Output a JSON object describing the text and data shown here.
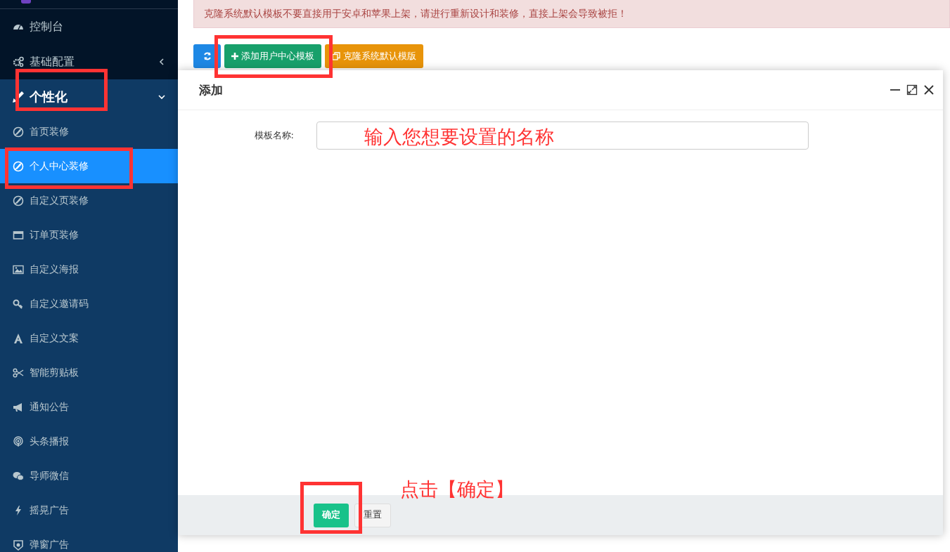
{
  "sidebar": {
    "items": [
      {
        "label": "控制台",
        "kind": "link",
        "selected": false
      },
      {
        "label": "基础配置",
        "kind": "group",
        "expanded": false,
        "selected": false
      },
      {
        "label": "个性化",
        "kind": "group",
        "expanded": true,
        "selected": false,
        "children": [
          {
            "label": "首页装修",
            "selected": false
          },
          {
            "label": "个人中心装修",
            "selected": true
          },
          {
            "label": "自定义页装修",
            "selected": false
          },
          {
            "label": "订单页装修",
            "selected": false
          },
          {
            "label": "自定义海报",
            "selected": false
          },
          {
            "label": "自定义邀请码",
            "selected": false
          },
          {
            "label": "自定义文案",
            "selected": false
          },
          {
            "label": "智能剪贴板",
            "selected": false
          },
          {
            "label": "通知公告",
            "selected": false
          },
          {
            "label": "头条播报",
            "selected": false
          },
          {
            "label": "导师微信",
            "selected": false
          },
          {
            "label": "摇晃广告",
            "selected": false
          },
          {
            "label": "弹窗广告",
            "selected": false
          }
        ]
      }
    ]
  },
  "alert": {
    "text": "克隆系统默认模板不要直接用于安卓和苹果上架，请进行重新设计和装修，直接上架会导致被拒！"
  },
  "toolbar": {
    "buttons": [
      {
        "kind": "refresh"
      },
      {
        "kind": "add",
        "label": "添加用户中心模板"
      },
      {
        "kind": "clone",
        "label": "克隆系统默认模版"
      }
    ]
  },
  "dialog": {
    "title": "添加",
    "fields": [
      {
        "label": "模板名称:"
      }
    ],
    "buttons": [
      {
        "kind": "primary",
        "label": "确定"
      },
      {
        "kind": "default",
        "label": "重置"
      }
    ]
  },
  "annotations": [
    {
      "text": "输入您想要设置的名称"
    },
    {
      "text": "点击【确定】"
    }
  ]
}
